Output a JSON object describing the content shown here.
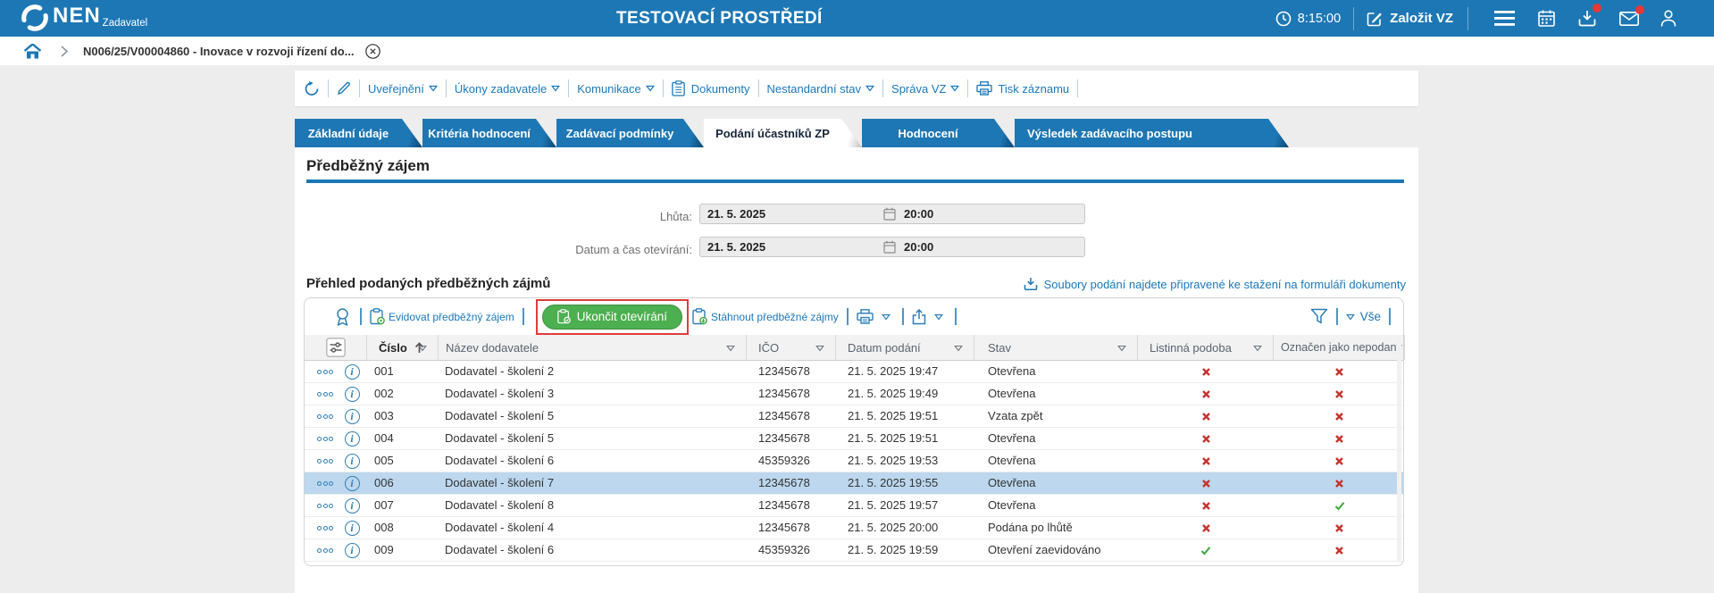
{
  "topbar": {
    "logo": "NEN",
    "role": "Zadavatel",
    "environment_title": "TESTOVACÍ PROSTŘEDÍ",
    "time": "8:15:00",
    "create_button": "Založit VZ"
  },
  "breadcrumb": {
    "title": "N006/25/V00004860 - Inovace v rozvoji řízení do..."
  },
  "action_menu": {
    "items": [
      {
        "label": "Uveřejnění",
        "caret": true,
        "icon": null
      },
      {
        "label": "Úkony zadavatele",
        "caret": true,
        "icon": null
      },
      {
        "label": "Komunikace",
        "caret": true,
        "icon": null
      },
      {
        "label": "Dokumenty",
        "caret": false,
        "icon": "document"
      },
      {
        "label": "Nestandardní stav",
        "caret": true,
        "icon": null
      },
      {
        "label": "Správa VZ",
        "caret": true,
        "icon": null
      },
      {
        "label": "Tisk záznamu",
        "caret": false,
        "icon": "printer"
      }
    ]
  },
  "tabs": [
    {
      "label": "Základní údaje",
      "active": false
    },
    {
      "label": "Kritéria hodnocení",
      "active": false
    },
    {
      "label": "Zadávací podmínky",
      "active": false
    },
    {
      "label": "Podání účastníků ZP",
      "active": true
    },
    {
      "label": "Hodnocení",
      "active": false
    },
    {
      "label": "Výsledek zadávacího postupu",
      "active": false
    }
  ],
  "section": {
    "title": "Předběžný zájem"
  },
  "fields": [
    {
      "label": "Lhůta:",
      "date": "21. 5. 2025",
      "time": "20:00"
    },
    {
      "label": "Datum a čas otevírání:",
      "date": "21. 5. 2025",
      "time": "20:00"
    }
  ],
  "table": {
    "title": "Přehled podaných předběžných zájmů",
    "download_note": "Soubory podání najdete připravené ke stažení na formuláři dokumenty",
    "toolbar": {
      "evidovat": "Evidovat předběžný zájem",
      "ukoncit": "Ukončit otevírání",
      "stahnout": "Stáhnout předběžné zájmy",
      "vse": "Vše"
    },
    "columns": [
      "Číslo",
      "Název dodavatele",
      "IČO",
      "Datum podání",
      "Stav",
      "Listinná podoba",
      "Označen jako nepodaný"
    ],
    "rows": [
      {
        "cislo": "001",
        "nazev": "Dodavatel - školení 2",
        "ico": "12345678",
        "datum": "21. 5. 2025 19:47",
        "stav": "Otevřena",
        "listinna": false,
        "nepodany": false,
        "selected": false
      },
      {
        "cislo": "002",
        "nazev": "Dodavatel - školení 3",
        "ico": "12345678",
        "datum": "21. 5. 2025 19:49",
        "stav": "Otevřena",
        "listinna": false,
        "nepodany": false,
        "selected": false
      },
      {
        "cislo": "003",
        "nazev": "Dodavatel - školení 5",
        "ico": "12345678",
        "datum": "21. 5. 2025 19:51",
        "stav": "Vzata zpět",
        "listinna": false,
        "nepodany": false,
        "selected": false
      },
      {
        "cislo": "004",
        "nazev": "Dodavatel - školení 5",
        "ico": "12345678",
        "datum": "21. 5. 2025 19:51",
        "stav": "Otevřena",
        "listinna": false,
        "nepodany": false,
        "selected": false
      },
      {
        "cislo": "005",
        "nazev": "Dodavatel - školení 6",
        "ico": "45359326",
        "datum": "21. 5. 2025 19:53",
        "stav": "Otevřena",
        "listinna": false,
        "nepodany": false,
        "selected": false
      },
      {
        "cislo": "006",
        "nazev": "Dodavatel - školení 7",
        "ico": "12345678",
        "datum": "21. 5. 2025 19:55",
        "stav": "Otevřena",
        "listinna": false,
        "nepodany": false,
        "selected": true
      },
      {
        "cislo": "007",
        "nazev": "Dodavatel - školení 8",
        "ico": "12345678",
        "datum": "21. 5. 2025 19:57",
        "stav": "Otevřena",
        "listinna": false,
        "nepodany": true,
        "selected": false
      },
      {
        "cislo": "008",
        "nazev": "Dodavatel - školení 4",
        "ico": "12345678",
        "datum": "21. 5. 2025 20:00",
        "stav": "Podána po lhůtě",
        "listinna": false,
        "nepodany": false,
        "selected": false
      },
      {
        "cislo": "009",
        "nazev": "Dodavatel - školení 6",
        "ico": "45359326",
        "datum": "21. 5. 2025 19:59",
        "stav": "Otevření zaevidováno",
        "listinna": true,
        "nepodany": false,
        "selected": false
      }
    ]
  }
}
